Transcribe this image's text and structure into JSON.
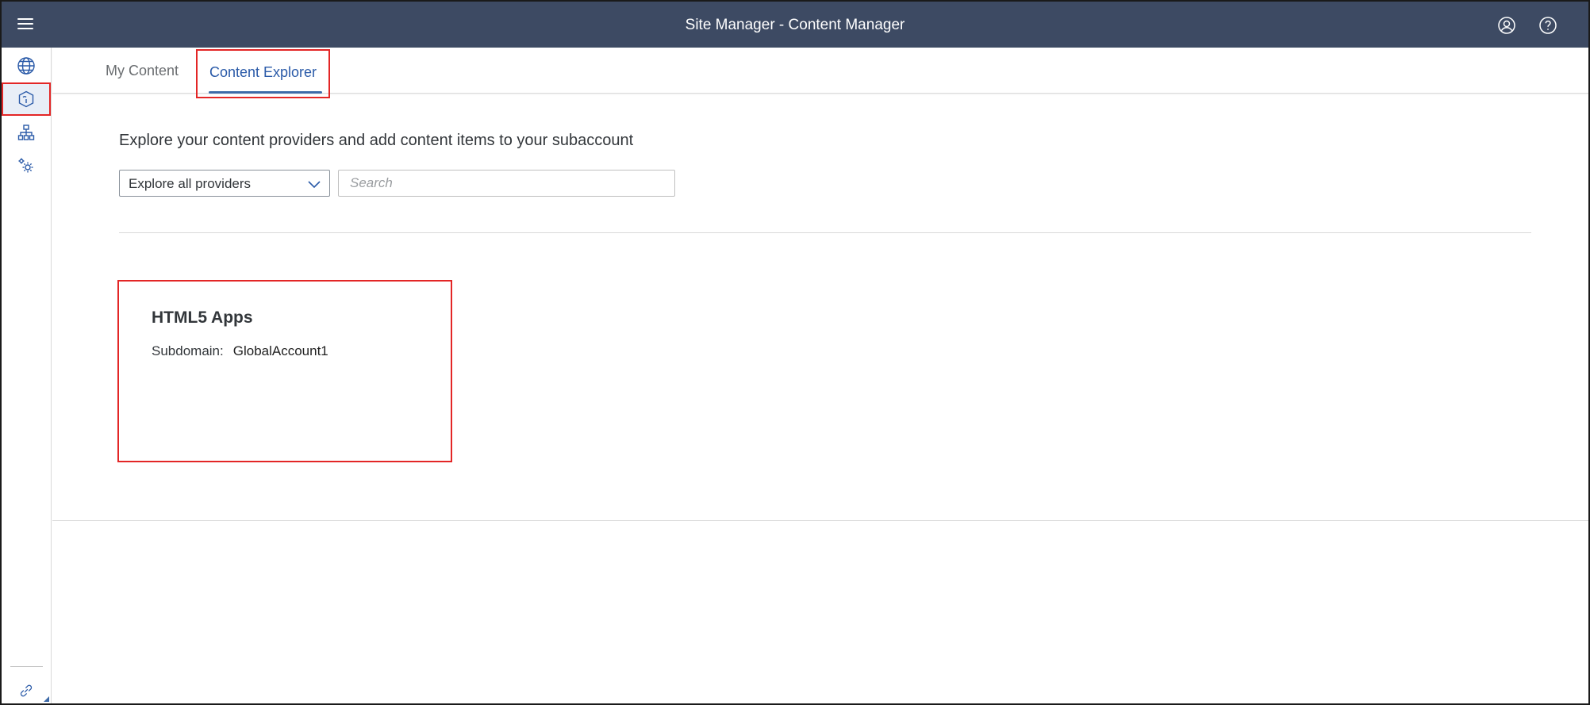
{
  "shell": {
    "title": "Site Manager - Content Manager",
    "menu_icon": "menu-icon",
    "user_icon": "user-icon",
    "help_icon": "help-icon",
    "bg_color": "#3d4a63"
  },
  "sidenav": {
    "items": [
      {
        "icon": "globe-icon",
        "active": false
      },
      {
        "icon": "package-icon",
        "active": true
      },
      {
        "icon": "hierarchy-icon",
        "active": false
      },
      {
        "icon": "settings-icon",
        "active": false
      }
    ],
    "bottom_icon": "link-icon"
  },
  "tabs": [
    {
      "label": "My Content",
      "selected": false
    },
    {
      "label": "Content Explorer",
      "selected": true
    }
  ],
  "main": {
    "intro": "Explore your content providers and add content items to your subaccount",
    "provider_select": {
      "value": "Explore all providers"
    },
    "search": {
      "placeholder": "Search",
      "value": ""
    },
    "cards": [
      {
        "title": "HTML5 Apps",
        "subdomain_label": "Subdomain:",
        "subdomain_value": "GlobalAccount1"
      }
    ]
  },
  "colors": {
    "accent": "#3d6aa8",
    "highlight_border": "#e32626"
  }
}
